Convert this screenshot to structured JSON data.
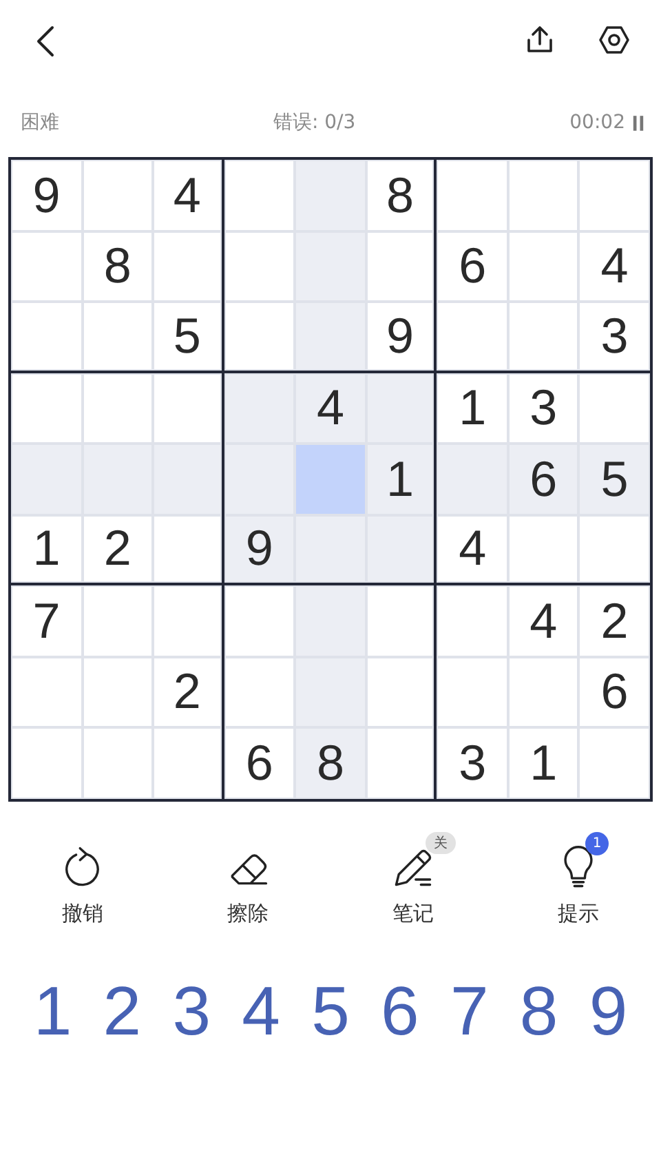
{
  "status": {
    "difficulty": "困难",
    "mistakes": "错误: 0/3",
    "timer": "00:02",
    "paused": false
  },
  "board": {
    "rows": [
      [
        {
          "value": "9",
          "selected": false
        },
        {
          "selected": false
        },
        {
          "value": "4",
          "selected": false
        },
        {
          "selected": false
        },
        {
          "selected": false
        },
        {
          "value": "8",
          "selected": false
        },
        {
          "selected": false
        },
        {
          "selected": false
        },
        {
          "selected": false
        }
      ],
      [
        {
          "selected": false
        },
        {
          "value": "8",
          "selected": false
        },
        {
          "selected": false
        },
        {
          "selected": false
        },
        {
          "selected": false
        },
        {
          "selected": false
        },
        {
          "value": "6",
          "selected": false
        },
        {
          "selected": false
        },
        {
          "value": "4",
          "selected": false
        }
      ],
      [
        {
          "selected": false
        },
        {
          "selected": false
        },
        {
          "value": "5",
          "selected": false
        },
        {
          "selected": false
        },
        {
          "selected": false
        },
        {
          "value": "9",
          "selected": false
        },
        {
          "selected": false
        },
        {
          "selected": false
        },
        {
          "value": "3",
          "selected": false
        }
      ],
      [
        {
          "selected": false
        },
        {
          "selected": false
        },
        {
          "selected": false
        },
        {
          "selected": false
        },
        {
          "value": "4",
          "selected": false
        },
        {
          "selected": false
        },
        {
          "value": "1",
          "selected": false
        },
        {
          "value": "3",
          "selected": false
        },
        {
          "selected": false
        }
      ],
      [
        {
          "selected": false
        },
        {
          "selected": false
        },
        {
          "selected": false
        },
        {
          "selected": false
        },
        {
          "selected": true
        },
        {
          "value": "1",
          "selected": false
        },
        {
          "selected": false
        },
        {
          "value": "6",
          "selected": false
        },
        {
          "value": "5",
          "selected": false
        }
      ],
      [
        {
          "value": "1",
          "selected": false
        },
        {
          "value": "2",
          "selected": false
        },
        {
          "selected": false
        },
        {
          "value": "9",
          "selected": false
        },
        {
          "selected": false
        },
        {
          "selected": false
        },
        {
          "value": "4",
          "selected": false
        },
        {
          "selected": false
        },
        {
          "selected": false
        }
      ],
      [
        {
          "value": "7",
          "selected": false
        },
        {
          "selected": false
        },
        {
          "selected": false
        },
        {
          "selected": false
        },
        {
          "selected": false
        },
        {
          "selected": false
        },
        {
          "selected": false
        },
        {
          "value": "4",
          "selected": false
        },
        {
          "value": "2",
          "selected": false
        }
      ],
      [
        {
          "selected": false
        },
        {
          "selected": false
        },
        {
          "value": "2",
          "selected": false
        },
        {
          "selected": false
        },
        {
          "selected": false
        },
        {
          "selected": false
        },
        {
          "selected": false
        },
        {
          "selected": false
        },
        {
          "value": "6",
          "selected": false
        }
      ],
      [
        {
          "selected": false
        },
        {
          "selected": false
        },
        {
          "selected": false
        },
        {
          "value": "6",
          "selected": false
        },
        {
          "value": "8",
          "selected": false
        },
        {
          "selected": false
        },
        {
          "value": "3",
          "selected": false
        },
        {
          "value": "1",
          "selected": false
        },
        {
          "selected": false
        }
      ]
    ]
  },
  "tools": [
    {
      "kind": "undo",
      "label": "撤销"
    },
    {
      "kind": "erase",
      "label": "擦除"
    },
    {
      "kind": "notes",
      "label": "笔记",
      "badge": "关"
    },
    {
      "kind": "hint",
      "label": "提示",
      "badge": "1"
    }
  ],
  "numbers": [
    "1",
    "2",
    "3",
    "4",
    "5",
    "6",
    "7",
    "8",
    "9"
  ]
}
